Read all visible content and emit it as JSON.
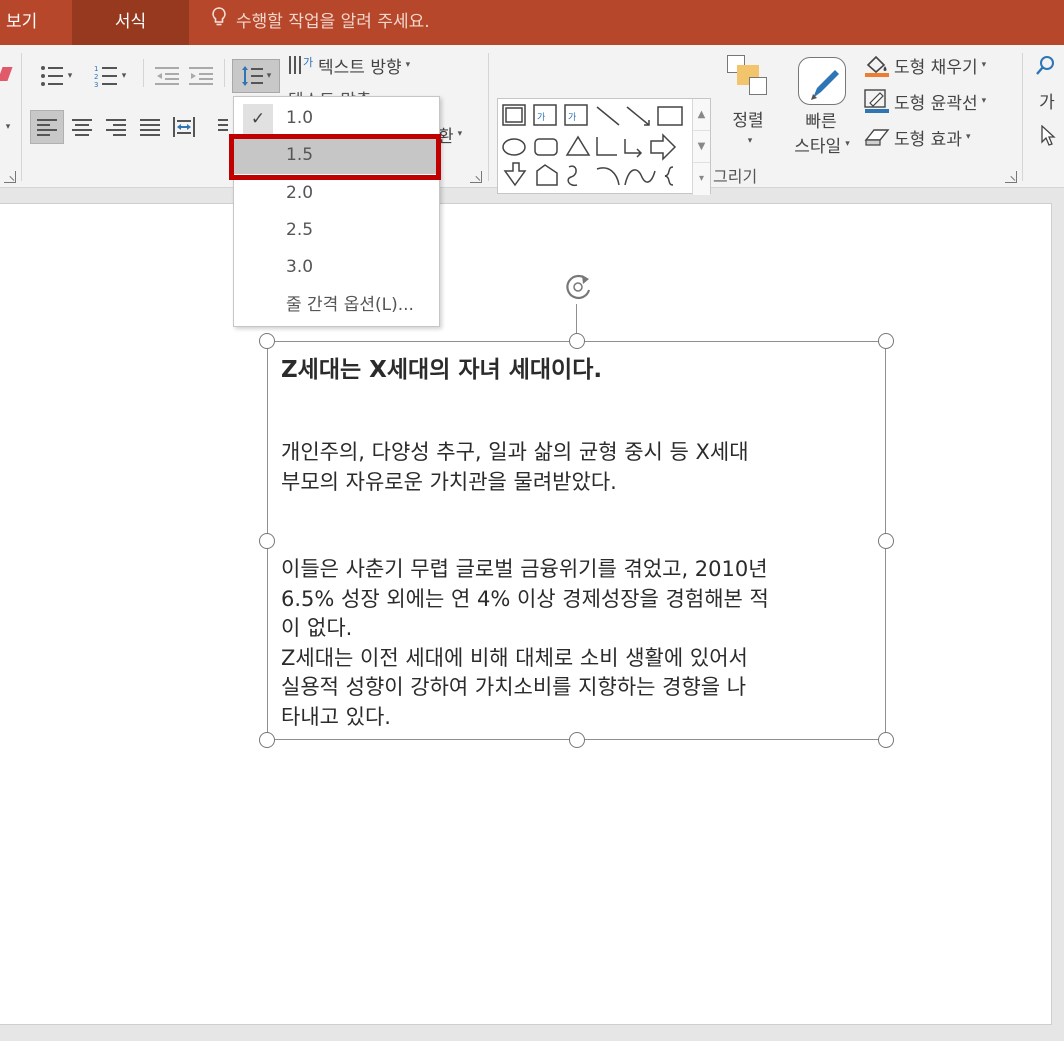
{
  "tabs": {
    "view": "보기",
    "format": "서식"
  },
  "tell_me": "수행할 작업을 알려 주세요.",
  "ribbon": {
    "text_direction": "텍스트 방향",
    "text_align_hidden": "텍스트 맞춤",
    "smartart_partial": "환",
    "arrange": "정렬",
    "quick_styles_line1": "빠른",
    "quick_styles_line2": "스타일",
    "shape_fill": "도형 채우기",
    "shape_outline": "도형 윤곽선",
    "shape_effects": "도형 효과",
    "drawing_group": "그리기",
    "find_partial": "가"
  },
  "line_spacing_menu": {
    "items": [
      "1.0",
      "1.5",
      "2.0",
      "2.5",
      "3.0"
    ],
    "checked": "1.0",
    "hovered": "1.5",
    "options": "줄 간격 옵션(L)..."
  },
  "textbox": {
    "title": "Z세대는 X세대의 자녀 세대이다.",
    "para1": [
      "개인주의, 다양성 추구, 일과 삶의 균형 중시 등 X세대",
      "부모의 자유로운 가치관을 물려받았다."
    ],
    "para2": [
      "이들은 사춘기 무렵 글로벌 금융위기를 겪었고, 2010년",
      "6.5% 성장 외에는 연 4% 이상 경제성장을 경험해본 적",
      "이 없다.",
      "Z세대는 이전 세대에 비해 대체로 소비 생활에 있어서",
      "실용적 성향이 강하여 가치소비를 지향하는 경향을 나",
      "타내고 있다."
    ]
  },
  "colors": {
    "tab_bar": "#b7472a",
    "active_tab": "#97391f",
    "highlight": "#c00000"
  }
}
